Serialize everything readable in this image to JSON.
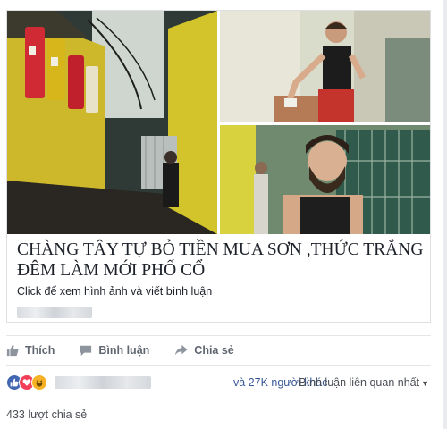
{
  "preview": {
    "headline": "CHÀNG TÂY TỰ BỎ TIỀN MUA SƠN ,THỨC TRẮNG ĐÊM LÀM MỚI PHỐ CỔ",
    "subtext": "Click để xem hình ảnh và viết bình luận",
    "photos": [
      "alley-photo",
      "man-painting-wall-photo",
      "bearded-man-portrait-photo"
    ]
  },
  "actions": {
    "like_label": "Thích",
    "comment_label": "Bình luận",
    "share_label": "Chia sẻ"
  },
  "reactions": {
    "icons": [
      "like-icon",
      "love-icon",
      "haha-icon"
    ],
    "others_text": "và 27K người khác",
    "sort_label": "Bình luận liên quan nhất"
  },
  "shares": {
    "count_text": "433 lượt chia sẻ"
  },
  "colors": {
    "link_blue": "#385898",
    "like_blue": "#4267b2",
    "love_red": "#f33e58",
    "haha_yellow": "#f7b125",
    "action_gray": "#606770"
  }
}
